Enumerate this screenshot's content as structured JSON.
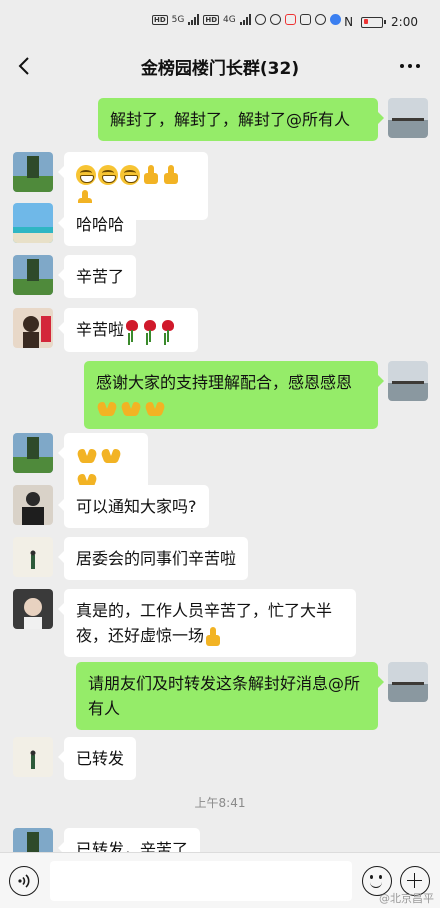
{
  "status_bar": {
    "hd1": "HD",
    "hd2": "HD",
    "net1": "5G",
    "net2": "4G",
    "nfc": "N",
    "time": "2:00"
  },
  "header": {
    "title": "金榜园楼门长群(32)"
  },
  "messages": [
    {
      "id": "m1",
      "side": "right",
      "text": "解封了，解封了，解封了@所有人",
      "avatar": "lake-sunset-avatar"
    },
    {
      "id": "m2",
      "side": "left",
      "emojis": [
        "grin",
        "grin",
        "grin",
        "thumbs-up",
        "thumbs-up",
        "thumbs-up"
      ],
      "avatar": "trees-field-avatar"
    },
    {
      "id": "m3",
      "side": "left",
      "text": "哈哈哈",
      "avatar": "beach-avatar"
    },
    {
      "id": "m4",
      "side": "left",
      "text": "辛苦了",
      "avatar": "trees-field-avatar"
    },
    {
      "id": "m5",
      "side": "left",
      "text": "辛苦啦",
      "emojis": [
        "rose",
        "rose",
        "rose"
      ],
      "avatar": "girl-red-avatar"
    },
    {
      "id": "m6",
      "side": "right",
      "text": "感谢大家的支持理解配合，感恩感恩",
      "emojis": [
        "pray",
        "pray",
        "pray"
      ],
      "avatar": "lake-sunset-avatar"
    },
    {
      "id": "m7",
      "side": "left",
      "emojis": [
        "pray",
        "pray",
        "pray"
      ],
      "avatar": "trees-field-avatar"
    },
    {
      "id": "m8",
      "side": "left",
      "text": "可以通知大家吗?",
      "avatar": "person-dark-avatar"
    },
    {
      "id": "m9",
      "side": "left",
      "text": "居委会的同事们辛苦啦",
      "avatar": "minimal-figure-avatar"
    },
    {
      "id": "m10",
      "side": "left",
      "text": "真是的，工作人员辛苦了，忙了大半夜，还好虚惊一场",
      "emojis": [
        "thumbs-up"
      ],
      "avatar": "child-avatar"
    },
    {
      "id": "m11",
      "side": "right",
      "text": "请朋友们及时转发这条解封好消息@所有人",
      "avatar": "lake-sunset-avatar"
    },
    {
      "id": "m12",
      "side": "left",
      "text": "已转发",
      "avatar": "minimal-figure-avatar"
    },
    {
      "id": "m13",
      "side": "left",
      "text": "已转发，辛苦了",
      "avatar": "trees-field-avatar"
    }
  ],
  "timestamp": "上午8:41",
  "watermark": "@北京昌平",
  "colors": {
    "background": "#ededed",
    "bubble_out": "#95ec69",
    "bubble_in": "#ffffff"
  }
}
